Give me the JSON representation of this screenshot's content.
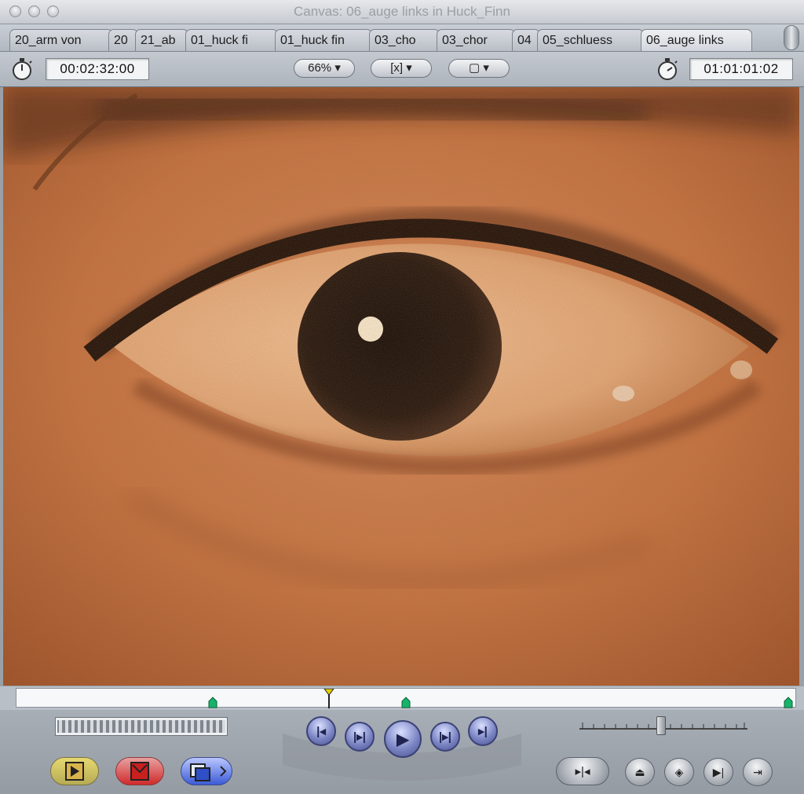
{
  "window": {
    "title": "Canvas: 06_auge links in Huck_Finn"
  },
  "tabs": [
    {
      "label": "20_arm von",
      "active": false
    },
    {
      "label": "20",
      "active": false
    },
    {
      "label": "21_ab",
      "active": false
    },
    {
      "label": "01_huck fi",
      "active": false
    },
    {
      "label": "01_huck fin",
      "active": false
    },
    {
      "label": "03_cho",
      "active": false
    },
    {
      "label": "03_chor",
      "active": false
    },
    {
      "label": "04",
      "active": false
    },
    {
      "label": "05_schluess",
      "active": false
    },
    {
      "label": "06_auge links",
      "active": true
    }
  ],
  "toolbar": {
    "duration": "00:02:32:00",
    "zoom": "66%",
    "view_mode_glyph": "[x]",
    "overlay_glyph": "▢",
    "current_timecode": "01:01:01:02"
  },
  "icons": {
    "duration_clock": "stopwatch-icon",
    "current_clock": "stopwatch-icon",
    "go_to_in": "go-to-in-point-icon",
    "prev_edit": "previous-edit-icon",
    "play": "play-icon",
    "next_edit": "next-edit-icon",
    "go_to_out": "go-to-out-point-icon",
    "insert": "insert-edit-icon",
    "overwrite": "overwrite-edit-icon",
    "replace": "replace-edit-icon"
  },
  "colors": {
    "insert": "#e6d870",
    "overwrite": "#d02a2a",
    "replace": "#3b5bd6",
    "marker": "#18b36a",
    "playhead": "#e8d000"
  },
  "scrubber": {
    "playhead_fraction": 0.4,
    "markers_fraction": [
      0.25,
      0.5,
      0.995
    ]
  }
}
